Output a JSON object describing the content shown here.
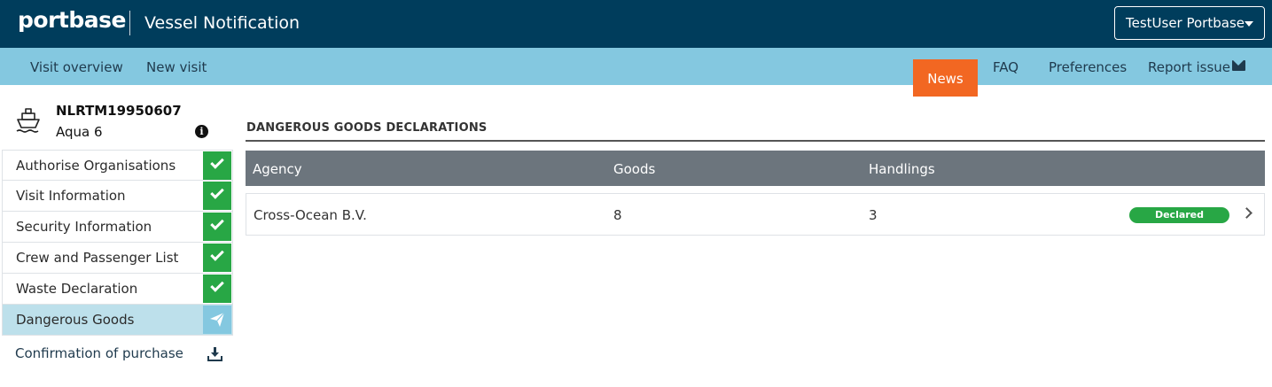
{
  "header": {
    "logo_text": "portbase",
    "app_title": "Vessel Notification",
    "user_label": "TestUser Portbase",
    "colors": {
      "header_bg": "#003d5c",
      "logo_accent": "#f26722"
    }
  },
  "subnav": {
    "left_links": [
      "Visit overview",
      "New visit"
    ],
    "news": "News",
    "faq": "FAQ",
    "preferences": "Preferences",
    "report_issue": "Report issue",
    "report_icon": "envelope-icon",
    "colors": {
      "bg": "#84c8e0",
      "news_bg": "#f26722"
    }
  },
  "vessel": {
    "icon": "ship-icon",
    "id": "NLRTM19950607",
    "name": "Aqua 6",
    "info_icon": "info-icon"
  },
  "sidebar": {
    "items": [
      {
        "label": "Authorise Organisations",
        "status": "complete",
        "icon": "check-icon"
      },
      {
        "label": "Visit Information",
        "status": "complete",
        "icon": "check-icon"
      },
      {
        "label": "Security Information",
        "status": "complete",
        "icon": "check-icon"
      },
      {
        "label": "Crew and Passenger List",
        "status": "complete",
        "icon": "check-icon"
      },
      {
        "label": "Waste Declaration",
        "status": "complete",
        "icon": "check-icon"
      },
      {
        "label": "Dangerous Goods",
        "status": "sent",
        "icon": "paper-plane-icon",
        "active": true
      }
    ],
    "purchase_label": "Confirmation of purchase",
    "purchase_icon": "download-icon",
    "colors": {
      "complete": "#28a745",
      "active_bg": "#bde0eb",
      "sent": "#84c8e0"
    }
  },
  "main": {
    "section_title": "DANGEROUS GOODS DECLARATIONS",
    "columns": [
      "Agency",
      "Goods",
      "Handlings"
    ],
    "rows": [
      {
        "agency": "Cross-Ocean B.V.",
        "goods": "8",
        "handlings": "3",
        "status": "Declared"
      }
    ],
    "colors": {
      "header_bg": "#6c757d",
      "badge": "#28a745"
    }
  }
}
